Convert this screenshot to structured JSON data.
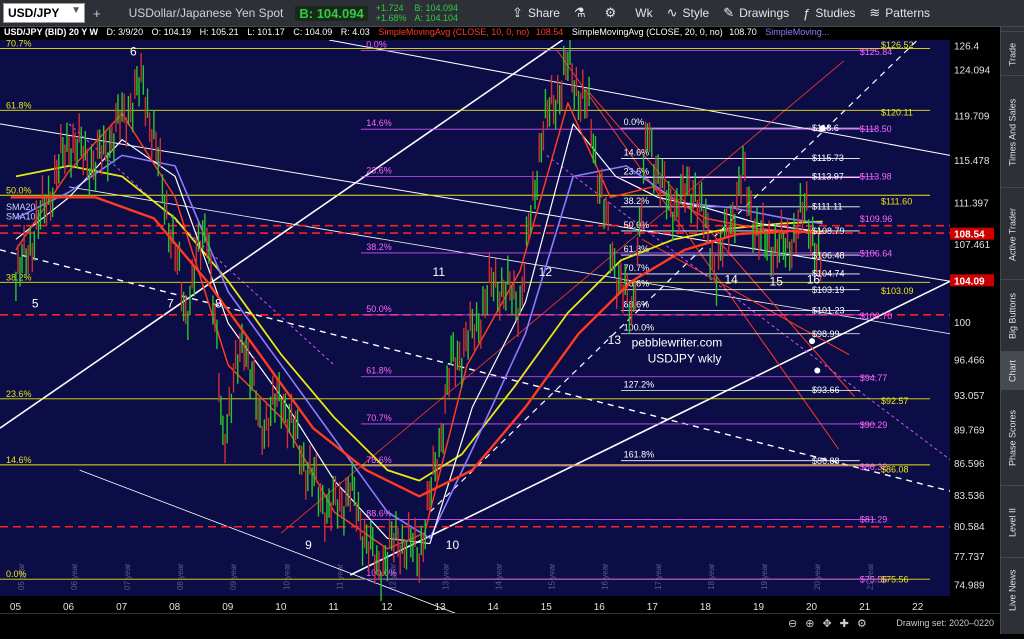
{
  "toolbar": {
    "symbol": "USD/JPY",
    "description": "USDollar/Japanese Yen Spot",
    "bid_label": "B: 104.094",
    "change": "+1.724",
    "change_pct": "+1.68%",
    "bid_small": "B: 104.094",
    "ask_small": "A: 104.104",
    "buttons": [
      {
        "icon": "share-icon",
        "glyph": "⇪",
        "label": "Share"
      },
      {
        "icon": "flask-icon",
        "glyph": "⚗",
        "label": ""
      },
      {
        "icon": "gear-icon",
        "glyph": "⚙",
        "label": ""
      },
      {
        "icon": "timeframe-icon",
        "glyph": "",
        "label": "Wk"
      },
      {
        "icon": "style-icon",
        "glyph": "∿",
        "label": "Style"
      },
      {
        "icon": "pencil-icon",
        "glyph": "✎",
        "label": "Drawings"
      },
      {
        "icon": "studies-icon",
        "glyph": "ƒ",
        "label": "Studies"
      },
      {
        "icon": "patterns-icon",
        "glyph": "≋",
        "label": "Patterns"
      }
    ]
  },
  "subheader": {
    "title": "USD/JPY (BID) 20 Y W",
    "date": "D: 3/9/20",
    "open": "O: 104.19",
    "high": "H: 105.21",
    "low": "L: 101.17",
    "close": "C: 104.09",
    "range": "R: 4.03",
    "sma10": "SimpleMovingAvg (CLOSE, 10, 0, no)",
    "sma10_val": "108.54",
    "sma20": "SimpleMovingAvg (CLOSE, 20, 0, no)",
    "sma20_val": "108.70",
    "sma_more": "SimpleMoving..."
  },
  "colors": {
    "background": "#000000",
    "plot_bg": "#0c0c46",
    "sma10": "#ff3b20",
    "sma20": "#ffffff",
    "yellow_ma": "#e8e815",
    "purple_ma": "#8a7cff",
    "red_ma": "#ff3b20",
    "fib_left": "#e8e815",
    "fib_mid": "#cc55ff",
    "fib_white": "#ffffff",
    "annotation_pink": "#ff66ff"
  },
  "chart_data": {
    "type": "line",
    "title": "USD/JPY (BID) 20 Y W",
    "xlabel": "",
    "ylabel": "",
    "x_ticks": [
      "05",
      "06",
      "07",
      "08",
      "09",
      "10",
      "11",
      "12",
      "13",
      "14",
      "15",
      "16",
      "17",
      "18",
      "19",
      "20",
      "21",
      "22"
    ],
    "y_ticks": [
      126.4,
      124.094,
      119.709,
      115.478,
      111.397,
      107.461,
      100,
      96.466,
      93.057,
      89.769,
      86.596,
      83.536,
      80.584,
      77.737,
      74.989
    ],
    "ylim": [
      74.0,
      127.0
    ],
    "price_markers": [
      {
        "label": "108.54",
        "value": 108.54,
        "color": "#cc0000"
      },
      {
        "label": "104.09",
        "value": 104.09,
        "color": "#cc0000"
      }
    ],
    "series": [
      {
        "name": "USD/JPY",
        "x": [
          2005.0,
          2005.5,
          2006.0,
          2006.5,
          2007.0,
          2007.4,
          2007.8,
          2008.2,
          2008.6,
          2008.9,
          2009.3,
          2009.6,
          2010.0,
          2010.5,
          2010.9,
          2011.3,
          2011.8,
          2012.2,
          2012.6,
          2012.9,
          2013.2,
          2013.6,
          2014.0,
          2014.5,
          2014.9,
          2015.4,
          2015.8,
          2016.2,
          2016.6,
          2016.9,
          2017.3,
          2017.8,
          2018.2,
          2018.7,
          2019.0,
          2019.5,
          2019.9,
          2020.2
        ],
        "y": [
          104.0,
          110.5,
          117.5,
          115.0,
          119.5,
          123.0,
          112.0,
          101.0,
          110.0,
          89.0,
          99.0,
          90.0,
          93.0,
          86.0,
          82.0,
          84.0,
          76.5,
          79.5,
          78.0,
          86.0,
          96.0,
          99.0,
          104.0,
          102.0,
          118.0,
          124.5,
          120.0,
          107.0,
          100.5,
          118.0,
          111.0,
          113.0,
          105.0,
          114.0,
          108.0,
          107.0,
          111.0,
          104.09
        ]
      },
      {
        "name": "SimpleMovingAvg (CLOSE, 10, 0, no)",
        "x": [
          2005.0,
          2006.0,
          2007.0,
          2008.0,
          2009.0,
          2010.0,
          2011.0,
          2012.0,
          2012.7,
          2013.5,
          2014.5,
          2015.4,
          2016.2,
          2017.0,
          2018.0,
          2019.0,
          2020.2
        ],
        "y": [
          107.0,
          114.5,
          120.0,
          112.0,
          96.0,
          91.0,
          82.0,
          78.5,
          80.0,
          96.0,
          105.0,
          121.0,
          112.0,
          113.0,
          110.0,
          109.0,
          108.54
        ]
      },
      {
        "name": "SimpleMovingAvg (CLOSE, 20, 0, no)",
        "x": [
          2005.0,
          2006.0,
          2007.0,
          2008.0,
          2009.0,
          2010.0,
          2011.0,
          2012.0,
          2012.8,
          2013.6,
          2014.6,
          2015.5,
          2016.3,
          2017.1,
          2018.0,
          2019.0,
          2020.2
        ],
        "y": [
          108.0,
          112.0,
          117.5,
          114.0,
          100.0,
          93.0,
          85.0,
          79.5,
          79.0,
          92.0,
          102.0,
          119.0,
          114.0,
          112.0,
          111.0,
          109.5,
          108.7
        ]
      },
      {
        "name": "",
        "x": [
          2005.0,
          2006.0,
          2007.0,
          2008.0,
          2009.0,
          2010.0,
          2011.0,
          2012.0,
          2012.8,
          2013.6,
          2014.6,
          2015.5,
          2016.5,
          2017.5,
          2018.5,
          2019.5,
          2020.2
        ],
        "y": [
          110.0,
          112.5,
          116.0,
          115.0,
          103.0,
          96.0,
          89.0,
          82.0,
          79.5,
          88.0,
          99.0,
          114.0,
          115.0,
          111.5,
          111.0,
          110.0,
          109.5
        ]
      },
      {
        "name": "",
        "x": [
          2005.0,
          2006.0,
          2007.0,
          2008.0,
          2009.0,
          2010.0,
          2011.0,
          2012.0,
          2012.6,
          2013.4,
          2014.4,
          2015.4,
          2016.4,
          2017.4,
          2018.4,
          2019.4,
          2020.2
        ],
        "y": [
          114.0,
          115.0,
          114.0,
          110.0,
          104.0,
          97.0,
          91.0,
          86.0,
          85.0,
          87.5,
          94.0,
          101.0,
          106.0,
          108.0,
          109.0,
          109.5,
          109.7
        ]
      }
    ],
    "fib_left": [
      {
        "label": "70.7%",
        "value": 126.2
      },
      {
        "label": "61.8%",
        "value": 120.3
      },
      {
        "label": "50.0%",
        "value": 112.2
      },
      {
        "label": "SMA20",
        "value": 110.6
      },
      {
        "label": "SMA10",
        "value": 109.7
      },
      {
        "label": "38.2%",
        "value": 103.9
      },
      {
        "label": "23.6%",
        "value": 92.8
      },
      {
        "label": "14.6%",
        "value": 86.5
      },
      {
        "label": "0.0%",
        "value": 75.6
      }
    ],
    "fib_mid": [
      {
        "label": "0.0%",
        "value": 126.0
      },
      {
        "label": "14.6%",
        "value": 118.5
      },
      {
        "label": "23.6%",
        "value": 114.0
      },
      {
        "label": "38.2%",
        "value": 106.7
      },
      {
        "label": "50.0%",
        "value": 100.8
      },
      {
        "label": "61.8%",
        "value": 94.9
      },
      {
        "label": "70.7%",
        "value": 90.4
      },
      {
        "label": "78.6%",
        "value": 86.4
      },
      {
        "label": "88.6%",
        "value": 81.3
      },
      {
        "label": "100.0%",
        "value": 75.6
      }
    ],
    "fib_white": [
      {
        "label": "0.0%",
        "value": 118.6
      },
      {
        "label": "14.6%",
        "value": 115.7
      },
      {
        "label": "23.6%",
        "value": 113.9
      },
      {
        "label": "38.2%",
        "value": 111.1
      },
      {
        "label": "50.0%",
        "value": 108.8
      },
      {
        "label": "61.8%",
        "value": 106.5
      },
      {
        "label": "70.7%",
        "value": 104.7
      },
      {
        "label": "78.6%",
        "value": 103.2
      },
      {
        "label": "88.6%",
        "value": 101.2
      },
      {
        "label": "100.0%",
        "value": 99.0
      },
      {
        "label": "127.2%",
        "value": 93.6
      },
      {
        "label": "161.8%",
        "value": 86.9
      }
    ],
    "right_values": [
      {
        "text": "$126.52",
        "value": 126.52,
        "color": "#e8e815"
      },
      {
        "text": "$125.84",
        "value": 125.84,
        "color": "#ff66ff"
      },
      {
        "text": "$120.11",
        "value": 120.11,
        "color": "#e8e815"
      },
      {
        "text": "$118.6",
        "value": 118.6,
        "color": "#ffffff"
      },
      {
        "text": "$118.50",
        "value": 118.5,
        "color": "#ff66ff"
      },
      {
        "text": "$115.73",
        "value": 115.73,
        "color": "#ffffff"
      },
      {
        "text": "$113.97",
        "value": 113.97,
        "color": "#ffffff"
      },
      {
        "text": "$113.98",
        "value": 113.98,
        "color": "#ff66ff"
      },
      {
        "text": "$111.60",
        "value": 111.6,
        "color": "#e8e815"
      },
      {
        "text": "$111.11",
        "value": 111.11,
        "color": "#ffffff"
      },
      {
        "text": "$109.96",
        "value": 109.96,
        "color": "#ff66ff"
      },
      {
        "text": "$108.79",
        "value": 108.79,
        "color": "#ffffff"
      },
      {
        "text": "$106.48",
        "value": 106.48,
        "color": "#ffffff"
      },
      {
        "text": "$106.64",
        "value": 106.64,
        "color": "#ff66ff"
      },
      {
        "text": "$104.74",
        "value": 104.74,
        "color": "#ffffff"
      },
      {
        "text": "$103.19",
        "value": 103.19,
        "color": "#ffffff"
      },
      {
        "text": "$103.09",
        "value": 103.09,
        "color": "#e8e815"
      },
      {
        "text": "$101.23",
        "value": 101.23,
        "color": "#ffffff"
      },
      {
        "text": "$100.70",
        "value": 100.7,
        "color": "#ff66ff"
      },
      {
        "text": "$98.99",
        "value": 98.99,
        "color": "#ffffff"
      },
      {
        "text": "$94.77",
        "value": 94.77,
        "color": "#ff66ff"
      },
      {
        "text": "$93.66",
        "value": 93.66,
        "color": "#ffffff"
      },
      {
        "text": "$92.57",
        "value": 92.57,
        "color": "#e8e815"
      },
      {
        "text": "$90.29",
        "value": 90.29,
        "color": "#ff66ff"
      },
      {
        "text": "$86.88",
        "value": 86.88,
        "color": "#ffffff"
      },
      {
        "text": "$86.32",
        "value": 86.32,
        "color": "#ff66ff"
      },
      {
        "text": "$86.08",
        "value": 86.08,
        "color": "#e8e815"
      },
      {
        "text": "$81.29",
        "value": 81.29,
        "color": "#ff66ff"
      },
      {
        "text": "$75.56",
        "value": 75.56,
        "color": "#ff66ff"
      },
      {
        "text": "$75.56",
        "value": 75.56,
        "color": "#e8e815"
      }
    ],
    "wave_labels": [
      {
        "text": "5",
        "x": 2005.3,
        "y": 101.5
      },
      {
        "text": "6",
        "x": 2007.15,
        "y": 125.5
      },
      {
        "text": "7",
        "x": 2007.85,
        "y": 101.5
      },
      {
        "text": "8",
        "x": 2008.75,
        "y": 101.5
      },
      {
        "text": "9",
        "x": 2010.45,
        "y": 78.5
      },
      {
        "text": "10",
        "x": 2013.1,
        "y": 78.5
      },
      {
        "text": "11",
        "x": 2012.85,
        "y": 104.5
      },
      {
        "text": "12",
        "x": 2014.85,
        "y": 104.5
      },
      {
        "text": "13",
        "x": 2016.15,
        "y": 98.0
      },
      {
        "text": "14",
        "x": 2018.35,
        "y": 103.8
      },
      {
        "text": "15",
        "x": 2019.2,
        "y": 103.6
      },
      {
        "text": "16",
        "x": 2019.9,
        "y": 103.8
      }
    ],
    "annotation": [
      "pebblewriter.com",
      "USDJPY wkly"
    ],
    "year_watermarks": [
      "05 year",
      "06 year",
      "07 year",
      "08 year",
      "09 year",
      "10 year",
      "11 year",
      "12 year",
      "13 year",
      "14 year",
      "15 year",
      "16 year",
      "17 year",
      "18 year",
      "19 year",
      "20 year",
      "21 year"
    ]
  },
  "right_sidebar": [
    "Trade",
    "Times And Sales",
    "Active Trader",
    "Big Buttons",
    "Chart",
    "Phase Scores",
    "Level II",
    "Live News"
  ],
  "footer": {
    "status": "Drawing set: 2020–0220"
  }
}
